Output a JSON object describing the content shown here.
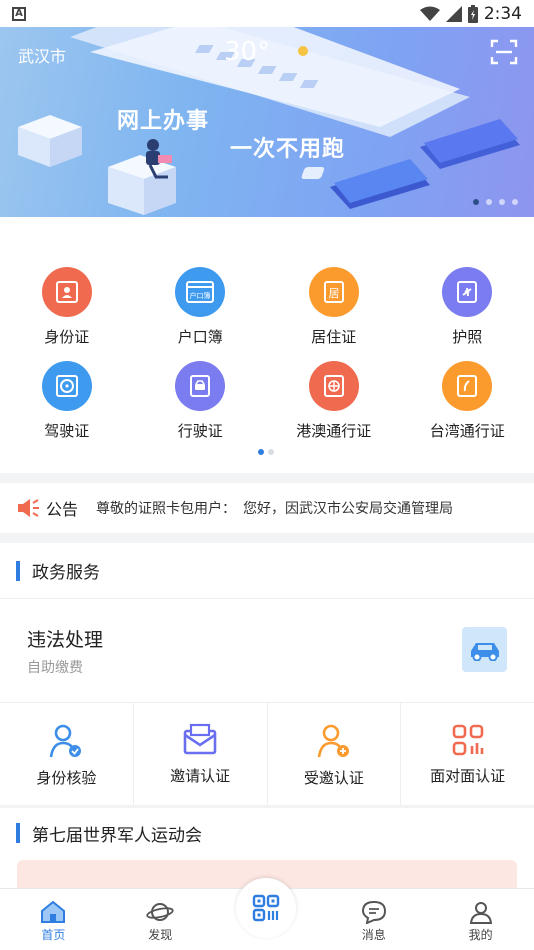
{
  "status_bar": {
    "time": "2:34",
    "notification_icon": "a-box-icon"
  },
  "banner": {
    "city": "武汉市",
    "temperature": "30°",
    "slogan_line1": "网上办事",
    "slogan_line2": "一次不用跑",
    "scan_icon": "scan-icon",
    "carousel_pages": 4,
    "carousel_active": 0
  },
  "services": [
    {
      "label": "身份证",
      "icon": "id-card-icon",
      "color": "#f06a4f"
    },
    {
      "label": "户口簿",
      "icon": "household-register-icon",
      "color": "#3d9aef"
    },
    {
      "label": "居住证",
      "icon": "residence-permit-icon",
      "color": "#fb9a2d"
    },
    {
      "label": "护照",
      "icon": "passport-icon",
      "color": "#7a7cf0"
    },
    {
      "label": "驾驶证",
      "icon": "driver-license-icon",
      "color": "#3d9aef"
    },
    {
      "label": "行驶证",
      "icon": "vehicle-license-icon",
      "color": "#7a7cf0"
    },
    {
      "label": "港澳通行证",
      "icon": "hk-macao-permit-icon",
      "color": "#f06a4f"
    },
    {
      "label": "台湾通行证",
      "icon": "taiwan-permit-icon",
      "color": "#fb9a2d"
    }
  ],
  "service_pager": {
    "pages": 2,
    "active": 0
  },
  "notice": {
    "title": "公告",
    "text": "尊敬的证照卡包用户：　您好，因武汉市公安局交通管理局"
  },
  "gov_service": {
    "title": "政务服务",
    "violation": {
      "title": "违法处理",
      "subtitle": "自助缴费"
    },
    "auth_items": [
      {
        "label": "身份核验",
        "icon": "identity-verify-icon"
      },
      {
        "label": "邀请认证",
        "icon": "invite-auth-icon"
      },
      {
        "label": "受邀认证",
        "icon": "invited-auth-icon"
      },
      {
        "label": "面对面认证",
        "icon": "face-to-face-auth-icon"
      }
    ]
  },
  "games": {
    "title": "第七届世界军人运动会"
  },
  "tabbar": {
    "tabs": [
      {
        "label": "首页",
        "icon": "home-icon",
        "active": true
      },
      {
        "label": "发现",
        "icon": "planet-icon",
        "active": false
      },
      {
        "label": "",
        "icon": "qr-code-icon",
        "active": false
      },
      {
        "label": "消息",
        "icon": "message-icon",
        "active": false
      },
      {
        "label": "我的",
        "icon": "profile-icon",
        "active": false
      }
    ]
  }
}
